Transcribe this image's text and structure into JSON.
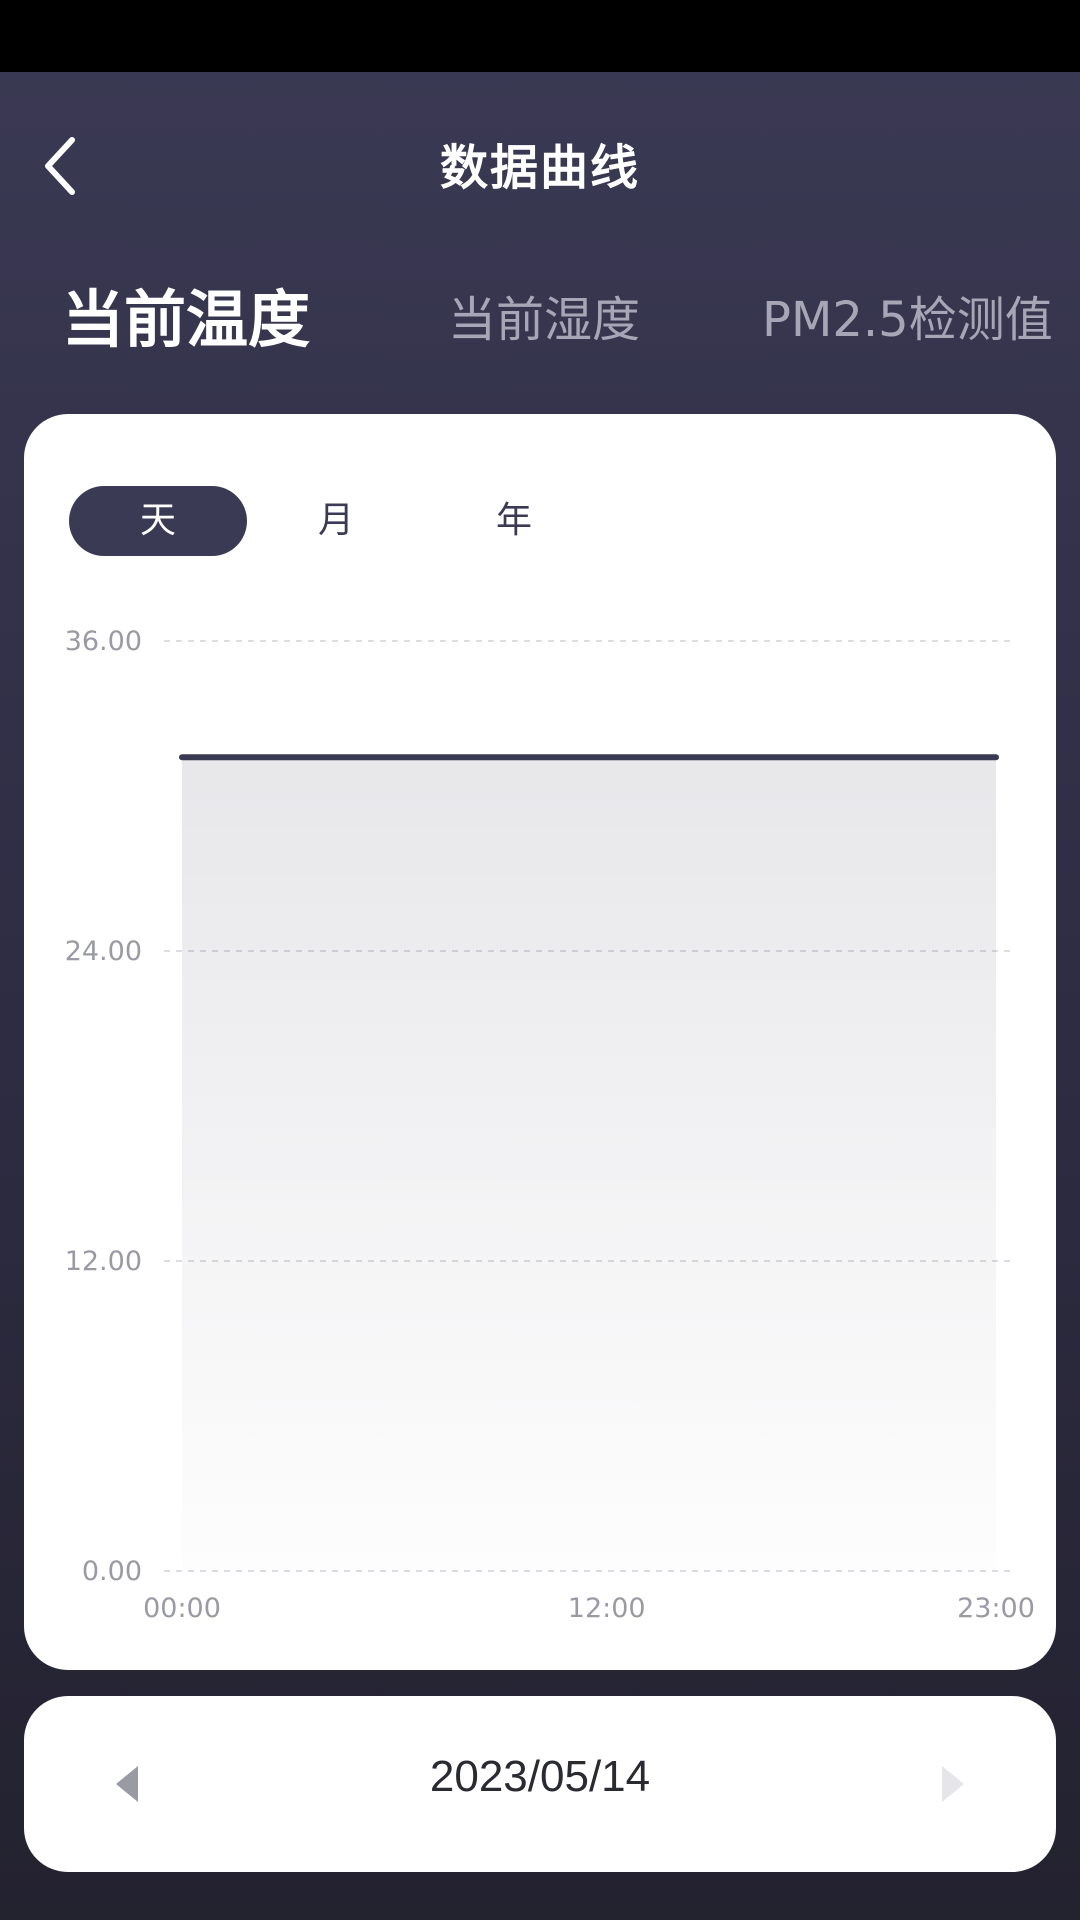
{
  "header": {
    "title": "数据曲线",
    "back_icon": "chevron-left-icon"
  },
  "metric_tabs": [
    {
      "label": "当前温度",
      "active": true
    },
    {
      "label": "当前湿度",
      "active": false
    },
    {
      "label": "PM2.5检测值",
      "active": false
    }
  ],
  "period_tabs": [
    {
      "label": "天",
      "active": true
    },
    {
      "label": "月",
      "active": false
    },
    {
      "label": "年",
      "active": false
    }
  ],
  "chart_data": {
    "type": "area",
    "x_ticks": [
      "00:00",
      "12:00",
      "23:00"
    ],
    "x": [
      "00:00",
      "23:00"
    ],
    "values": [
      31.5,
      31.5
    ],
    "y_ticks": [
      "36.00",
      "24.00",
      "12.00",
      "0.00"
    ],
    "ylim": [
      0,
      36
    ],
    "grid": true,
    "line_color": "#3b3a54"
  },
  "date_selector": {
    "date": "2023/05/14",
    "prev_icon": "triangle-left-icon",
    "next_icon": "triangle-right-icon"
  },
  "colors": {
    "accent": "#3b3a54",
    "tab_inactive": "#a7a6b6"
  }
}
